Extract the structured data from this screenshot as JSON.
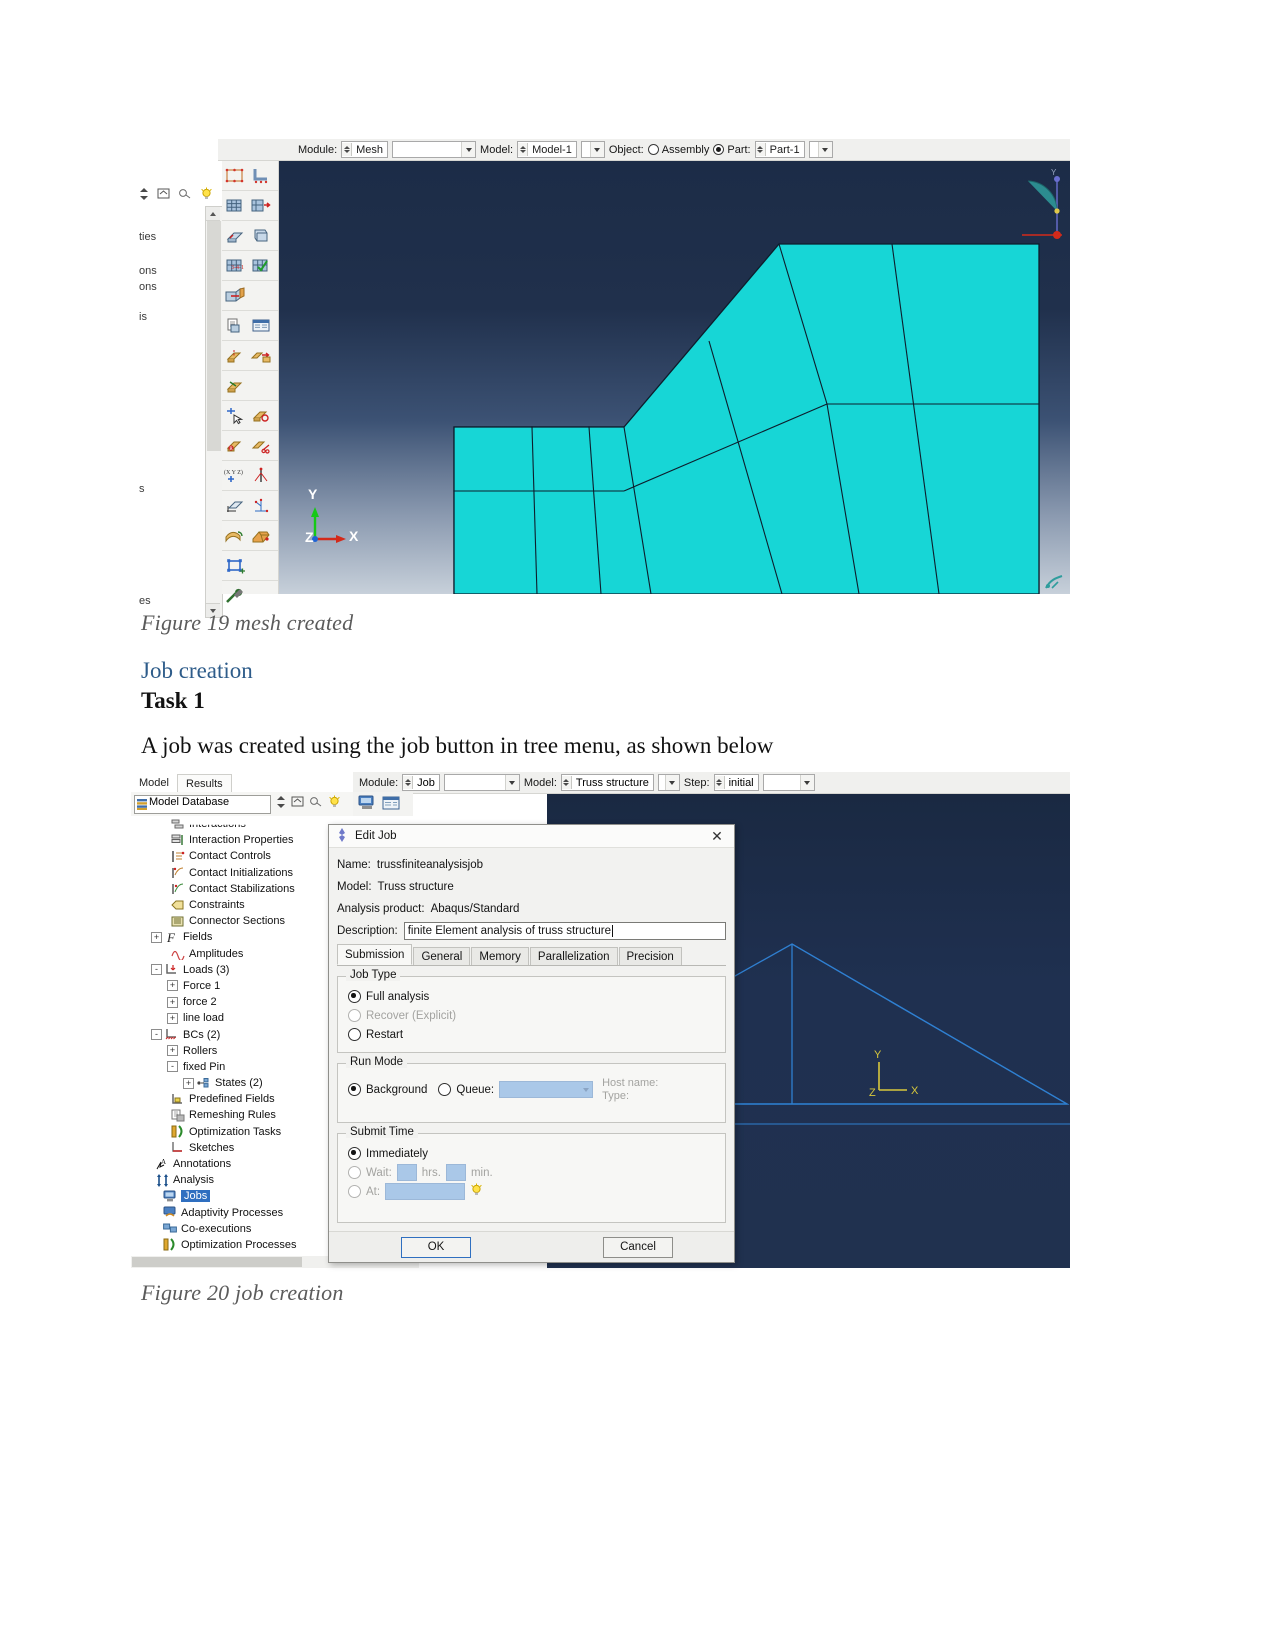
{
  "document": {
    "figure1_caption": "Figure 19 mesh created",
    "heading_job_creation": "Job creation",
    "heading_task1": "Task 1",
    "paragraph": "A job was created using the job button in tree menu,  as shown below",
    "figure2_caption": "Figure 20 job creation"
  },
  "figure1": {
    "toolbar": {
      "module_label": "Module:",
      "module_value": "Mesh",
      "model_label": "Model:",
      "model_value": "Model-1",
      "object_label": "Object:",
      "object_assembly": "Assembly",
      "object_part": "Part:",
      "part_value": "Part-1"
    },
    "sidebar_partial": [
      "ties",
      "ons",
      "ons",
      "is",
      "s",
      "es"
    ],
    "viewport": {
      "axis_y": "Y",
      "axis_x": "X",
      "axis_z": "Z",
      "mesh_color": "#1ad8d8",
      "mesh_edge_color": "#0e2030",
      "background_top": "#1c2c47",
      "background_bottom": "#c7d0da"
    }
  },
  "figure2": {
    "tabs": {
      "model": "Model",
      "results": "Results"
    },
    "database_selector": "Model Database",
    "toolbar": {
      "module_label": "Module:",
      "module_value": "Job",
      "model_label": "Model:",
      "model_value": "Truss structure",
      "step_label": "Step:",
      "step_value": "initial"
    },
    "tree": [
      {
        "label": "Interactions",
        "indent": 3,
        "box": "",
        "icon": "interactions-icon",
        "clipped": true
      },
      {
        "label": "Interaction Properties",
        "indent": 3,
        "box": "",
        "icon": "interaction-properties-icon"
      },
      {
        "label": "Contact Controls",
        "indent": 3,
        "box": "",
        "icon": "contact-controls-icon"
      },
      {
        "label": "Contact Initializations",
        "indent": 3,
        "box": "",
        "icon": "contact-initializations-icon"
      },
      {
        "label": "Contact Stabilizations",
        "indent": 3,
        "box": "",
        "icon": "contact-stabilizations-icon"
      },
      {
        "label": "Constraints",
        "indent": 3,
        "box": "",
        "icon": "constraints-icon"
      },
      {
        "label": "Connector Sections",
        "indent": 3,
        "box": "",
        "icon": "connector-sections-icon"
      },
      {
        "label": "Fields",
        "indent": 2,
        "box": "+",
        "icon": "fields-icon"
      },
      {
        "label": "Amplitudes",
        "indent": 3,
        "box": "",
        "icon": "amplitudes-icon"
      },
      {
        "label": "Loads (3)",
        "indent": 2,
        "box": "-",
        "icon": "loads-icon"
      },
      {
        "label": "Force 1",
        "indent": 4,
        "box": "+",
        "icon": ""
      },
      {
        "label": "force 2",
        "indent": 4,
        "box": "+",
        "icon": ""
      },
      {
        "label": "line load",
        "indent": 4,
        "box": "+",
        "icon": ""
      },
      {
        "label": "BCs (2)",
        "indent": 2,
        "box": "-",
        "icon": "bcs-icon"
      },
      {
        "label": "Rollers",
        "indent": 4,
        "box": "+",
        "icon": ""
      },
      {
        "label": "fixed Pin",
        "indent": 4,
        "box": "-",
        "icon": ""
      },
      {
        "label": "States (2)",
        "indent": 6,
        "box": "+",
        "icon": "states-icon"
      },
      {
        "label": "Predefined Fields",
        "indent": 3,
        "box": "",
        "icon": "predefined-fields-icon"
      },
      {
        "label": "Remeshing Rules",
        "indent": 3,
        "box": "",
        "icon": "remeshing-rules-icon"
      },
      {
        "label": "Optimization Tasks",
        "indent": 3,
        "box": "",
        "icon": "optimization-tasks-icon"
      },
      {
        "label": "Sketches",
        "indent": 3,
        "box": "",
        "icon": "sketches-icon"
      },
      {
        "label": "Annotations",
        "indent": 1,
        "box": "",
        "icon": "annotations-icon"
      },
      {
        "label": "Analysis",
        "indent": 1,
        "box": "",
        "icon": "analysis-icon"
      },
      {
        "label": "Jobs",
        "indent": 2,
        "box": "",
        "icon": "jobs-icon",
        "selected": true
      },
      {
        "label": "Adaptivity Processes",
        "indent": 2,
        "box": "",
        "icon": "adaptivity-icon"
      },
      {
        "label": "Co-executions",
        "indent": 2,
        "box": "",
        "icon": "co-executions-icon"
      },
      {
        "label": "Optimization Processes",
        "indent": 2,
        "box": "",
        "icon": "optimization-processes-icon"
      }
    ],
    "dialog": {
      "title": "Edit Job",
      "close": "✕",
      "name_label": "Name:",
      "name_value": "trussfiniteanalysisjob",
      "model_label": "Model:",
      "model_value": "Truss structure",
      "product_label": "Analysis product:",
      "product_value": "Abaqus/Standard",
      "description_label": "Description:",
      "description_value": "finite Element analysis of truss structure",
      "tabs": [
        "Submission",
        "General",
        "Memory",
        "Parallelization",
        "Precision"
      ],
      "active_tab": "Submission",
      "job_type": {
        "legend": "Job Type",
        "options": [
          "Full analysis",
          "Recover (Explicit)",
          "Restart"
        ],
        "selected": "Full analysis",
        "disabled": [
          "Recover (Explicit)"
        ]
      },
      "run_mode": {
        "legend": "Run Mode",
        "background": "Background",
        "queue": "Queue:",
        "queue_value": "",
        "host_name": "Host name:",
        "type": "Type:",
        "selected": "Background"
      },
      "submit_time": {
        "legend": "Submit Time",
        "immediately": "Immediately",
        "wait": "Wait:",
        "hrs": "hrs.",
        "min": "min.",
        "at": "At:",
        "wait_hrs_value": "",
        "wait_min_value": "",
        "at_value": "",
        "selected": "Immediately"
      },
      "ok": "OK",
      "cancel": "Cancel"
    }
  }
}
